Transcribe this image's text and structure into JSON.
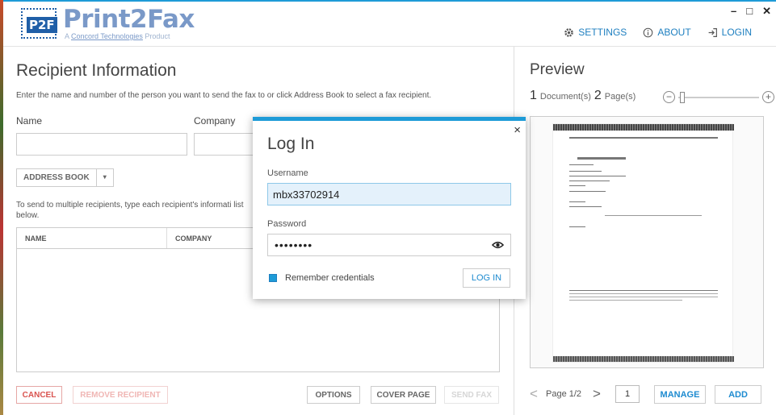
{
  "app": {
    "logo_badge": "P2F",
    "title": "Print2Fax",
    "subtitle_prefix": "A ",
    "subtitle_brand": "Concord Technologies",
    "subtitle_suffix": " Product",
    "accent": "#1e9bd7"
  },
  "nav": {
    "settings": "SETTINGS",
    "about": "ABOUT",
    "login": "LOGIN"
  },
  "window_controls": {
    "minimize": "–",
    "maximize": "□",
    "close": "✕"
  },
  "recipient": {
    "heading": "Recipient Information",
    "description": "Enter the name and number of the person you want to send the fax to or click Address Book to select a fax recipient.",
    "name_label": "Name",
    "company_label": "Company",
    "address_book": "ADDRESS BOOK",
    "dropdown_glyph": "▾",
    "multi_text": "To send to multiple recipients, type each recipient's informati list below.",
    "columns": [
      "NAME",
      "COMPANY"
    ]
  },
  "actions": {
    "cancel": "CANCEL",
    "remove": "REMOVE RECIPIENT",
    "options": "OPTIONS",
    "cover": "COVER PAGE",
    "send": "SEND FAX"
  },
  "preview": {
    "heading": "Preview",
    "doc_count": "1",
    "doc_label": "Document(s)",
    "page_count": "2",
    "page_label": "Page(s)",
    "zoom_out": "−",
    "zoom_in": "+",
    "page_text": "Page 1/2",
    "page_input": "1",
    "manage": "MANAGE",
    "add": "ADD",
    "prev_glyph": "<",
    "next_glyph": ">"
  },
  "login": {
    "title": "Log In",
    "close": "×",
    "username_label": "Username",
    "username_value": "mbx33702914",
    "password_label": "Password",
    "password_value": "••••••••",
    "remember": "Remember credentials",
    "remember_checked": true,
    "button": "LOG IN"
  }
}
